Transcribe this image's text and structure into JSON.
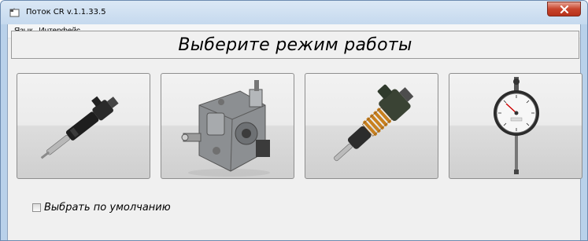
{
  "window": {
    "title": "Поток CR v.1.1.33.5"
  },
  "menu": {
    "items": [
      "Язык",
      "Интерфейс"
    ]
  },
  "main": {
    "heading": "Выберите режим работы",
    "modes": [
      {
        "name": "injector-cr",
        "icon": "common-rail-injector-icon"
      },
      {
        "name": "pump-cr",
        "icon": "high-pressure-pump-icon"
      },
      {
        "name": "pump-injector",
        "icon": "unit-injector-icon"
      },
      {
        "name": "dial-indicator",
        "icon": "dial-indicator-icon"
      }
    ],
    "default_checkbox": {
      "label": "Выбрать по умолчанию",
      "checked": false
    }
  },
  "colors": {
    "titlebar": "#c5d9ee",
    "close_button": "#c7442c",
    "client_bg": "#f0f0f0"
  }
}
